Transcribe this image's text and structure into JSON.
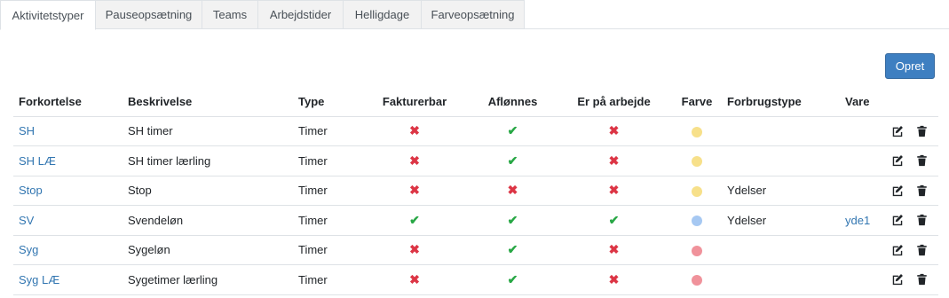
{
  "tabs": [
    {
      "label": "Aktivitetstyper",
      "active": true
    },
    {
      "label": "Pauseopsætning",
      "active": false
    },
    {
      "label": "Teams",
      "active": false
    },
    {
      "label": "Arbejdstider",
      "active": false
    },
    {
      "label": "Helligdage",
      "active": false
    },
    {
      "label": "Farveopsætning",
      "active": false
    }
  ],
  "create_button": "Opret",
  "columns": {
    "abbr": "Forkortelse",
    "desc": "Beskrivelse",
    "type": "Type",
    "billable": "Fakturerbar",
    "paid": "Aflønnes",
    "at_work": "Er på arbejde",
    "color": "Farve",
    "usage_type": "Forbrugstype",
    "item": "Vare"
  },
  "colors": {
    "check": "#28a745",
    "cross": "#dc3545",
    "link": "#3276b1",
    "yellow_dot": "#f7e08a",
    "blue_dot": "#a6c8f2",
    "red_dot": "#f0929b",
    "button": "#3e7fc1"
  },
  "rows": [
    {
      "abbr": "SH",
      "desc": "SH timer",
      "type": "Timer",
      "billable": false,
      "paid": true,
      "at_work": false,
      "color": "#f7e08a",
      "usage_type": "",
      "item": ""
    },
    {
      "abbr": "SH LÆ",
      "desc": "SH timer lærling",
      "type": "Timer",
      "billable": false,
      "paid": true,
      "at_work": false,
      "color": "#f7e08a",
      "usage_type": "",
      "item": ""
    },
    {
      "abbr": "Stop",
      "desc": "Stop",
      "type": "Timer",
      "billable": false,
      "paid": false,
      "at_work": false,
      "color": "#f7e08a",
      "usage_type": "Ydelser",
      "item": ""
    },
    {
      "abbr": "SV",
      "desc": "Svendeløn",
      "type": "Timer",
      "billable": true,
      "paid": true,
      "at_work": true,
      "color": "#a6c8f2",
      "usage_type": "Ydelser",
      "item": "yde1"
    },
    {
      "abbr": "Syg",
      "desc": "Sygeløn",
      "type": "Timer",
      "billable": false,
      "paid": true,
      "at_work": false,
      "color": "#f0929b",
      "usage_type": "",
      "item": ""
    },
    {
      "abbr": "Syg LÆ",
      "desc": "Sygetimer lærling",
      "type": "Timer",
      "billable": false,
      "paid": true,
      "at_work": false,
      "color": "#f0929b",
      "usage_type": "",
      "item": ""
    }
  ],
  "icons": {
    "edit": "edit-icon",
    "delete": "trash-icon",
    "check": "check-icon",
    "cross": "cross-icon"
  }
}
